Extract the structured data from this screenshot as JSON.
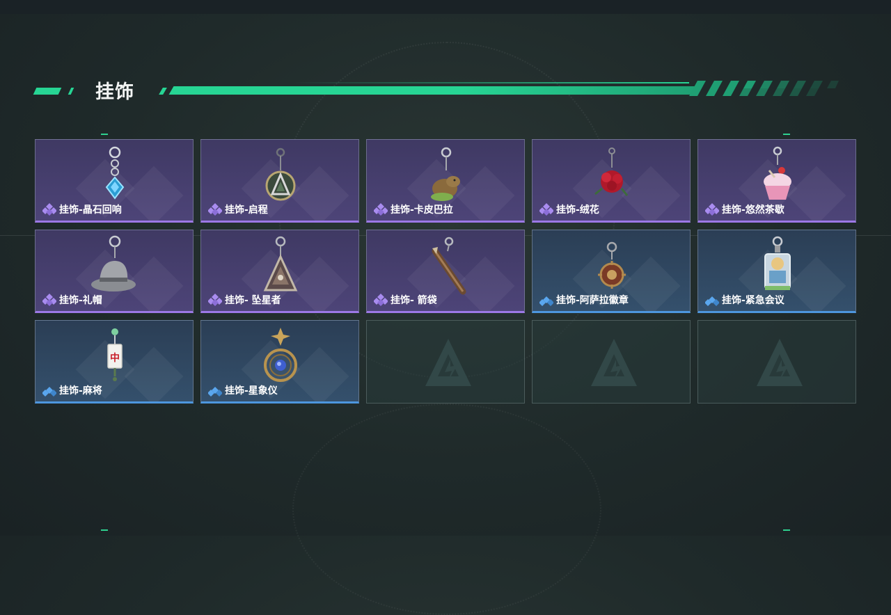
{
  "header": {
    "title": "挂饰"
  },
  "colors": {
    "accent": "#27d594",
    "epic": "#9c78e6",
    "rare": "#4d96de"
  },
  "items": [
    {
      "name": "挂饰-晶石回响",
      "rarity": "epic",
      "icon": "crystal-charm-icon"
    },
    {
      "name": "挂饰-启程",
      "rarity": "epic",
      "icon": "compass-medallion-icon"
    },
    {
      "name": "挂饰-卡皮巴拉",
      "rarity": "epic",
      "icon": "capybara-charm-icon"
    },
    {
      "name": "挂饰-绒花",
      "rarity": "epic",
      "icon": "red-flower-charm-icon"
    },
    {
      "name": "挂饰-悠然茶歇",
      "rarity": "epic",
      "icon": "cupcake-charm-icon"
    },
    {
      "name": "挂饰-礼帽",
      "rarity": "epic",
      "icon": "fedora-hat-icon"
    },
    {
      "name": "挂饰- 坠星者",
      "rarity": "epic",
      "icon": "triangle-pendant-icon"
    },
    {
      "name": "挂饰- 箭袋",
      "rarity": "epic",
      "icon": "quiver-charm-icon"
    },
    {
      "name": "挂饰-阿萨拉徽章",
      "rarity": "rare",
      "icon": "badge-medallion-icon"
    },
    {
      "name": "挂饰-紧急会议",
      "rarity": "rare",
      "icon": "figure-acrylic-icon"
    },
    {
      "name": "挂饰-麻将",
      "rarity": "rare",
      "icon": "mahjong-tile-icon"
    },
    {
      "name": "挂饰-星象仪",
      "rarity": "rare",
      "icon": "astrolabe-icon"
    }
  ],
  "empty_slots": 3
}
